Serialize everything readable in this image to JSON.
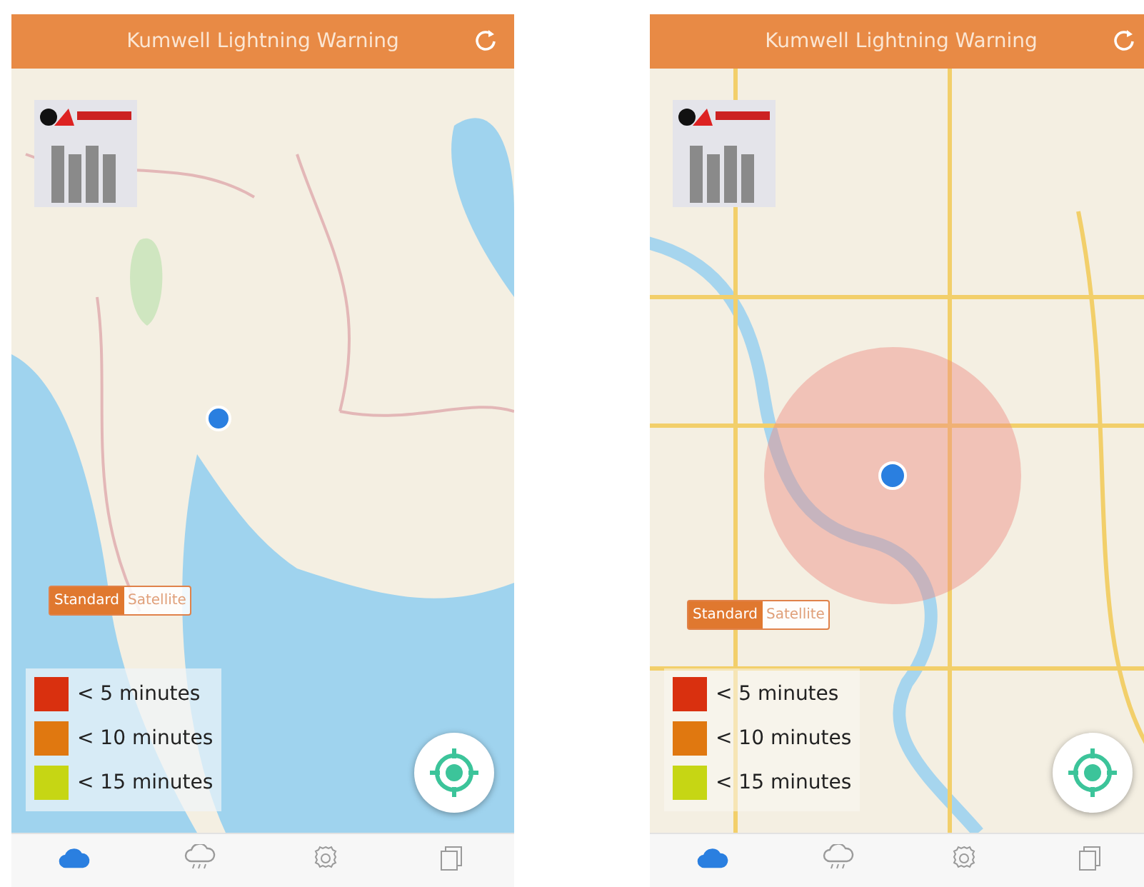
{
  "screens": [
    {
      "title": "Kumwell Lightning Warning",
      "map": {
        "kind": "region",
        "warning_zone": false
      },
      "map_type": [
        {
          "label": "Standard",
          "selected": true
        },
        {
          "label": "Satellite",
          "selected": false
        }
      ],
      "legend": [
        {
          "label": "< 5 minutes",
          "color": "#d9300f"
        },
        {
          "label": "< 10 minutes",
          "color": "#e07810"
        },
        {
          "label": "< 15 minutes",
          "color": "#c6d614"
        }
      ],
      "tabs": [
        {
          "kind": "cloud",
          "selected": true
        },
        {
          "kind": "rain",
          "selected": false
        },
        {
          "kind": "gear",
          "selected": false
        },
        {
          "kind": "pages",
          "selected": false
        }
      ]
    },
    {
      "title": "Kumwell Lightning Warning",
      "map": {
        "kind": "city",
        "warning_zone": true
      },
      "map_type": [
        {
          "label": "Standard",
          "selected": true
        },
        {
          "label": "Satellite",
          "selected": false
        }
      ],
      "legend": [
        {
          "label": "< 5 minutes",
          "color": "#d9300f"
        },
        {
          "label": "< 10 minutes",
          "color": "#e07810"
        },
        {
          "label": "< 15 minutes",
          "color": "#c6d614"
        }
      ],
      "tabs": [
        {
          "kind": "cloud",
          "selected": true
        },
        {
          "kind": "rain",
          "selected": false
        },
        {
          "kind": "gear",
          "selected": false
        },
        {
          "kind": "pages",
          "selected": false
        }
      ]
    }
  ]
}
